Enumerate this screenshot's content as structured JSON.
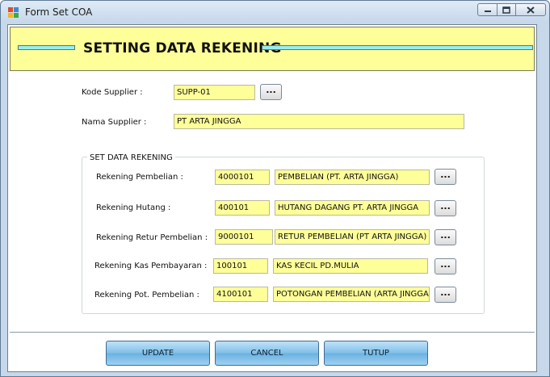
{
  "window": {
    "title": "Form Set COA"
  },
  "header": {
    "title": "SETTING DATA REKENING"
  },
  "supplier": {
    "kode_label": "Kode Supplier :",
    "kode_value": "SUPP-01",
    "nama_label": "Nama Supplier :",
    "nama_value": "PT ARTA JINGGA"
  },
  "browse_label": "...",
  "rekening": {
    "group_title": "SET DATA REKENING",
    "rows": [
      {
        "label": "Rekening Pembelian :",
        "code": "4000101",
        "name": "PEMBELIAN (PT. ARTA JINGGA)"
      },
      {
        "label": "Rekening Hutang :",
        "code": "400101",
        "name": "HUTANG DAGANG PT. ARTA JINGGA"
      },
      {
        "label": "Rekening Retur Pembelian :",
        "code": "9000101",
        "name": "RETUR PEMBELIAN (PT ARTA JINGGA)"
      },
      {
        "label": "Rekening Kas Pembayaran :",
        "code": "100101",
        "name": "KAS KECIL PD.MULIA"
      },
      {
        "label": "Rekening Pot. Pembelian :",
        "code": "4100101",
        "name": "POTONGAN PEMBELIAN (ARTA JINGGA)"
      }
    ]
  },
  "buttons": {
    "update": "UPDATE",
    "cancel": "CANCEL",
    "tutup": "TUTUP"
  },
  "colors": {
    "field_bg": "#ffff99",
    "header_bg": "#ffff99",
    "header_line": "#99eeee",
    "button": "#7fbfe8"
  },
  "icons": {
    "app": "form-app-icon",
    "minimize": "minimize-icon",
    "maximize": "maximize-icon",
    "close": "close-icon"
  }
}
